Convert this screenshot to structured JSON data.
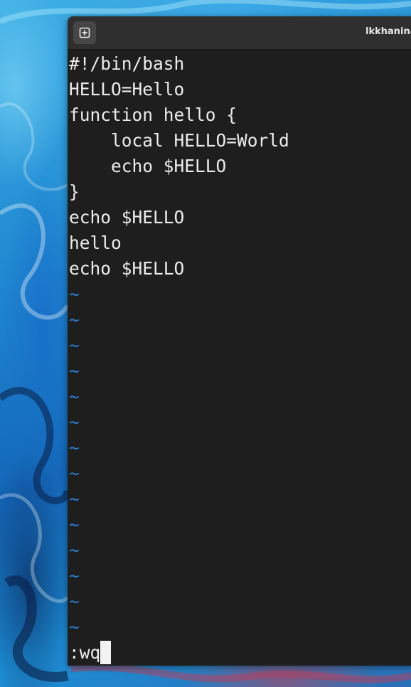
{
  "window": {
    "title": "lkkhanina"
  },
  "titlebar": {
    "new_tab_icon": "plus-square-icon"
  },
  "editor": {
    "lines": [
      "#!/bin/bash",
      "HELLO=Hello",
      "function hello {",
      "    local HELLO=World",
      "    echo $HELLO",
      "}",
      "echo $HELLO",
      "hello",
      "echo $HELLO"
    ],
    "empty_line_marker": "~",
    "empty_lines": [
      "~",
      "~",
      "~",
      "~",
      "~",
      "~",
      "~",
      "~",
      "~",
      "~",
      "~",
      "~",
      "~",
      "~"
    ],
    "command_line": ":wq"
  },
  "colors": {
    "terminal_bg": "#1e1e1e",
    "text": "#ececec",
    "tilde": "#2a7fd4",
    "titlebar": "#2f2f2f"
  }
}
